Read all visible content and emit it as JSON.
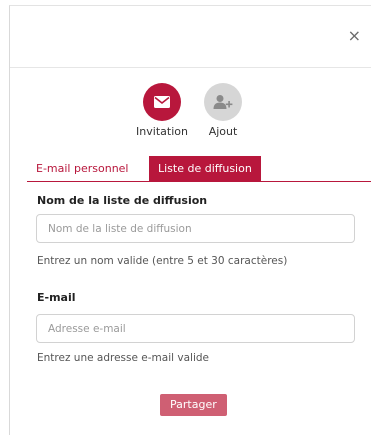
{
  "dialog": {
    "close_glyph": "×"
  },
  "modes": [
    {
      "label": "Invitation",
      "icon": "envelope-icon",
      "active": true
    },
    {
      "label": "Ajout",
      "icon": "add-user-icon",
      "active": false
    }
  ],
  "tabs": [
    {
      "label": "E-mail personnel",
      "active": false
    },
    {
      "label": "Liste de diffusion",
      "active": true
    }
  ],
  "form": {
    "list_name": {
      "label": "Nom de la liste de diffusion",
      "value": "",
      "placeholder": "Nom de la liste de diffusion",
      "hint": "Entrez un nom valide (entre 5 et 30 caractères)"
    },
    "email": {
      "label": "E-mail",
      "value": "",
      "placeholder": "Adresse e-mail",
      "hint": "Entrez une adresse e-mail valide"
    },
    "submit_label": "Partager"
  },
  "colors": {
    "accent": "#b8173c",
    "button_disabled": "#cf5f73",
    "inactive_icon_bg": "#d6d6d6"
  }
}
